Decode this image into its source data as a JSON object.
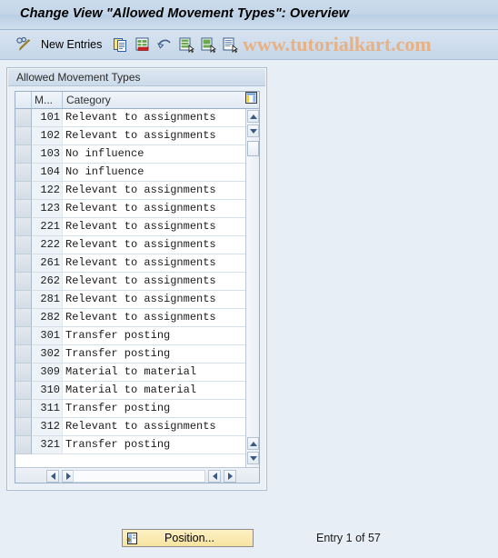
{
  "window": {
    "title": "Change View \"Allowed Movement Types\": Overview"
  },
  "toolbar": {
    "edit_icon": "pencil-glasses-icon",
    "new_entries_label": "New Entries",
    "icons": [
      {
        "name": "copy-icon"
      },
      {
        "name": "delete-row-icon"
      },
      {
        "name": "undo-icon"
      },
      {
        "name": "select-all-icon"
      },
      {
        "name": "deselect-all-icon"
      },
      {
        "name": "variant-icon"
      }
    ]
  },
  "watermark": {
    "text": "www.tutorialkart.com",
    "color": "#e8b183"
  },
  "panel": {
    "title": "Allowed Movement Types"
  },
  "table": {
    "columns": {
      "select": "",
      "key": "M...",
      "category": "Category",
      "config_icon": "table-settings-icon"
    },
    "rows": [
      {
        "key": "101",
        "category": "Relevant to assignments"
      },
      {
        "key": "102",
        "category": "Relevant to assignments"
      },
      {
        "key": "103",
        "category": "No influence"
      },
      {
        "key": "104",
        "category": "No influence"
      },
      {
        "key": "122",
        "category": "Relevant to assignments"
      },
      {
        "key": "123",
        "category": "Relevant to assignments"
      },
      {
        "key": "221",
        "category": "Relevant to assignments"
      },
      {
        "key": "222",
        "category": "Relevant to assignments"
      },
      {
        "key": "261",
        "category": "Relevant to assignments"
      },
      {
        "key": "262",
        "category": "Relevant to assignments"
      },
      {
        "key": "281",
        "category": "Relevant to assignments"
      },
      {
        "key": "282",
        "category": "Relevant to assignments"
      },
      {
        "key": "301",
        "category": "Transfer posting"
      },
      {
        "key": "302",
        "category": "Transfer posting"
      },
      {
        "key": "309",
        "category": "Material to material"
      },
      {
        "key": "310",
        "category": "Material to material"
      },
      {
        "key": "311",
        "category": "Transfer posting"
      },
      {
        "key": "312",
        "category": "Relevant to assignments"
      },
      {
        "key": "321",
        "category": "Transfer posting"
      }
    ]
  },
  "footer": {
    "position_button_label": "Position...",
    "entry_status": "Entry 1 of 57"
  },
  "colors": {
    "background": "#e8eef6",
    "titlebar": "#c6d7e9",
    "button_yellow": "#f7e3a0",
    "dropdown_arrow": "#2c4d7d"
  }
}
